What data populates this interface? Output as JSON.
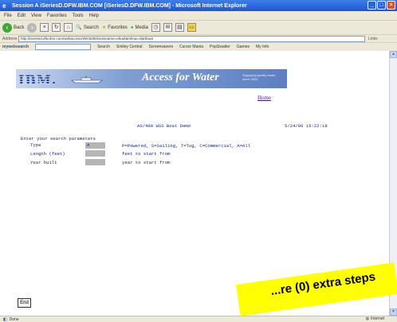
{
  "window": {
    "title": "Session A iSeriesD.DFW.IBM.COM [iSeriesD.DFW.IBM.COM] - Microsoft Internet Explorer",
    "min": "_",
    "max": "□",
    "close": "×"
  },
  "menubar": {
    "items": [
      "File",
      "Edit",
      "View",
      "Favorites",
      "Tools",
      "Help"
    ]
  },
  "toolbar": {
    "back_label": "Back",
    "search_label": "Search",
    "favorites_label": "Favorites",
    "media_label": "Media"
  },
  "addressbar": {
    "label": "Address",
    "url": "http://iseriesd.dfw.ibm.com/webaccess/iWA5250/sessname=ebuel&mlmw=slartboat",
    "go_label": "Links"
  },
  "linksbar": {
    "brand": "mywebsearch",
    "search_btn": "Search",
    "items": [
      "Smiley Central",
      "Screensavers",
      "Cursor Mania",
      "PopSwatter",
      "Games",
      "My Info"
    ]
  },
  "banner": {
    "logo": "IBM.",
    "title": "Access for Water",
    "tagline": "Supplying quality boats since 2002"
  },
  "content": {
    "home_link": "Home",
    "screen_title": "AS/400 WSS Boat Demo",
    "datetime": "5/24/06 15:22:18",
    "prompt": "Enter your search parameters",
    "rows": [
      {
        "label": "Type",
        "value": "A",
        "desc": "P=Powered, S=Sailing, T=Tug, C=Commercial, A=All"
      },
      {
        "label": "Length (feet)",
        "value": "",
        "desc": "feet to start from"
      },
      {
        "label": "Year built",
        "value": "",
        "desc": "year to start from"
      }
    ],
    "end_button": "End"
  },
  "statusbar": {
    "status": "Done",
    "zone": "Internet"
  },
  "sticky": {
    "text": "...re (0) extra steps"
  },
  "colors": {
    "titlebar": "#1d56d4",
    "chrome": "#ece9d8",
    "mono_text": "#1a237e",
    "input_field": "#b5b5b5",
    "sticky": "#ffff00"
  }
}
